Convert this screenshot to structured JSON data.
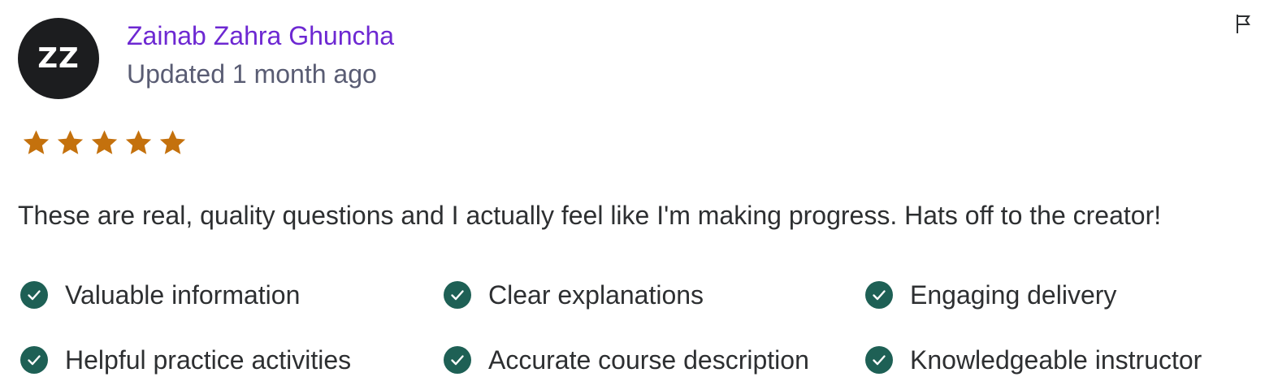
{
  "review": {
    "avatar_initials": "ZZ",
    "reviewer_name": "Zainab Zahra Ghuncha",
    "updated_text": "Updated 1 month ago",
    "rating": 5,
    "rating_max": 5,
    "text": "These are real, quality questions and I actually feel like I'm making progress. Hats off to the creator!",
    "tags": [
      "Valuable information",
      "Clear explanations",
      "Engaging delivery",
      "Helpful practice activities",
      "Accurate course description",
      "Knowledgeable instructor"
    ]
  },
  "icons": {
    "flag": "flag-icon",
    "star": "star-icon",
    "check": "check-circle-icon"
  },
  "colors": {
    "name": "#6d28d2",
    "star": "#c4710d",
    "check": "#1e6055",
    "avatar_bg": "#1c1d1f",
    "meta_text": "#595c73",
    "body_text": "#2d2f31"
  }
}
